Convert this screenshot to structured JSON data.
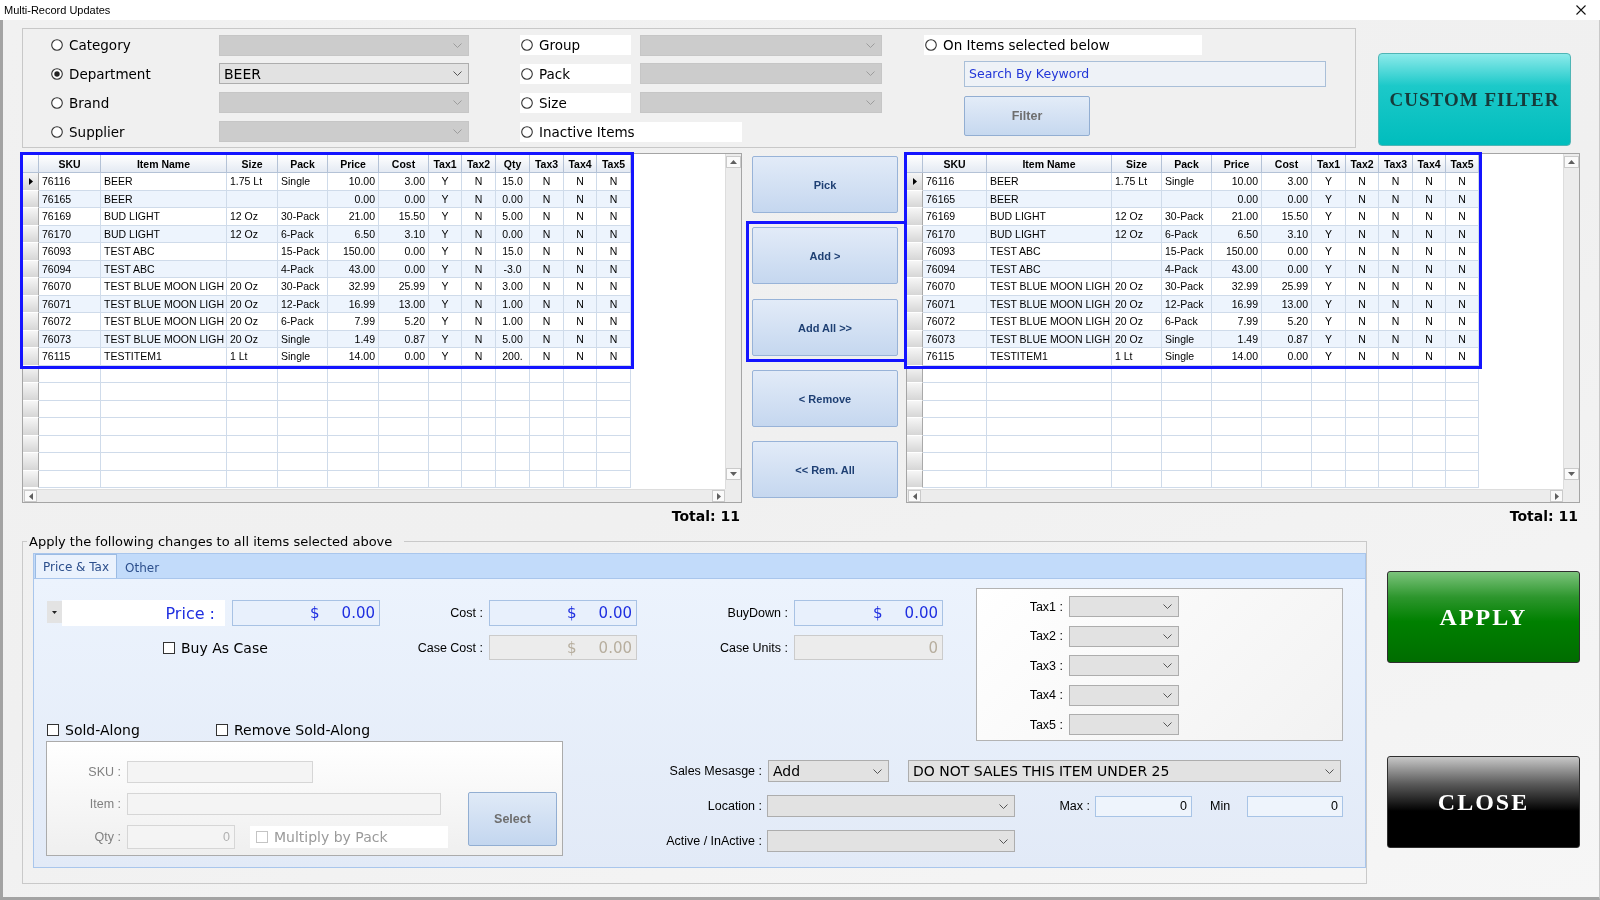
{
  "window": {
    "title": "Multi-Record Updates"
  },
  "filters": {
    "options": [
      {
        "label": "Category",
        "selected": false,
        "select": {
          "disabled": true
        }
      },
      {
        "label": "Department",
        "selected": true,
        "select": {
          "value": "BEER",
          "disabled": false
        }
      },
      {
        "label": "Brand",
        "selected": false,
        "select": {
          "disabled": true
        }
      },
      {
        "label": "Supplier",
        "selected": false,
        "select": {
          "disabled": true
        }
      },
      {
        "label": "Group",
        "selected": false,
        "select": {
          "disabled": true
        }
      },
      {
        "label": "Pack",
        "selected": false,
        "select": {
          "disabled": true
        }
      },
      {
        "label": "Size",
        "selected": false,
        "select": {
          "disabled": true
        }
      },
      {
        "label": "Inactive Items",
        "selected": false
      },
      {
        "label": "On Items selected below",
        "selected": false
      }
    ],
    "search": {
      "placeholder": "Search By Keyword"
    },
    "filter_button": {
      "label": "Filter",
      "disabled": true
    }
  },
  "custom_filter_button": {
    "label": "CUSTOM FILTER"
  },
  "left_grid": {
    "highlighted": true,
    "columns": [
      "SKU",
      "Item Name",
      "Size",
      "Pack",
      "Price",
      "Cost",
      "Tax1",
      "Tax2",
      "Qty",
      "Tax3",
      "Tax4",
      "Tax5"
    ],
    "rows": [
      {
        "selected": true,
        "cells": [
          "76116",
          "BEER",
          "1.75 Lt",
          "Single",
          "10.00",
          "3.00",
          "Y",
          "N",
          "15.0",
          "N",
          "N",
          "N"
        ]
      },
      {
        "selected": false,
        "cells": [
          "76165",
          "BEER",
          null,
          null,
          "0.00",
          "0.00",
          "Y",
          "N",
          "0.00",
          "N",
          "N",
          "N"
        ]
      },
      {
        "selected": false,
        "cells": [
          "76169",
          "BUD LIGHT",
          "12 Oz",
          "30-Pack",
          "21.00",
          "15.50",
          "Y",
          "N",
          "5.00",
          "N",
          "N",
          "N"
        ]
      },
      {
        "selected": false,
        "cells": [
          "76170",
          "BUD LIGHT",
          "12 Oz",
          "6-Pack",
          "6.50",
          "3.10",
          "Y",
          "N",
          "0.00",
          "N",
          "N",
          "N"
        ]
      },
      {
        "selected": false,
        "cells": [
          "76093",
          "TEST ABC",
          null,
          "15-Pack",
          "150.00",
          "0.00",
          "Y",
          "N",
          "15.0",
          "N",
          "N",
          "N"
        ]
      },
      {
        "selected": false,
        "cells": [
          "76094",
          "TEST ABC",
          null,
          "4-Pack",
          "43.00",
          "0.00",
          "Y",
          "N",
          "-3.0",
          "N",
          "N",
          "N"
        ]
      },
      {
        "selected": false,
        "cells": [
          "76070",
          "TEST BLUE MOON LIGH",
          "20 Oz",
          "30-Pack",
          "32.99",
          "25.99",
          "Y",
          "N",
          "3.00",
          "N",
          "N",
          "N"
        ]
      },
      {
        "selected": false,
        "cells": [
          "76071",
          "TEST BLUE MOON LIGH",
          "20 Oz",
          "12-Pack",
          "16.99",
          "13.00",
          "Y",
          "N",
          "1.00",
          "N",
          "N",
          "N"
        ]
      },
      {
        "selected": false,
        "cells": [
          "76072",
          "TEST BLUE MOON LIGH",
          "20 Oz",
          "6-Pack",
          "7.99",
          "5.20",
          "Y",
          "N",
          "1.00",
          "N",
          "N",
          "N"
        ]
      },
      {
        "selected": false,
        "cells": [
          "76073",
          "TEST BLUE MOON LIGH",
          "20 Oz",
          "Single",
          "1.49",
          "0.87",
          "Y",
          "N",
          "5.00",
          "N",
          "N",
          "N"
        ]
      },
      {
        "selected": false,
        "cells": [
          "76115",
          "TESTITEM1",
          "1 Lt",
          "Single",
          "14.00",
          "0.00",
          "Y",
          "N",
          "200.",
          "N",
          "N",
          "N"
        ]
      }
    ],
    "total": "Total: 11"
  },
  "transfer_buttons": [
    {
      "label": "Pick",
      "highlighted": false
    },
    {
      "label": "Add >",
      "highlighted": true
    },
    {
      "label": "Add All >>",
      "highlighted": true
    },
    {
      "label": "< Remove",
      "highlighted": false
    },
    {
      "label": "<< Rem. All",
      "highlighted": false
    }
  ],
  "right_grid": {
    "highlighted": true,
    "columns": [
      "SKU",
      "Item Name",
      "Size",
      "Pack",
      "Price",
      "Cost",
      "Tax1",
      "Tax2",
      "Tax3",
      "Tax4",
      "Tax5"
    ],
    "rows": [
      {
        "selected": true,
        "cells": [
          "76116",
          "BEER",
          "1.75 Lt",
          "Single",
          "10.00",
          "3.00",
          "Y",
          "N",
          "N",
          "N",
          "N"
        ]
      },
      {
        "selected": false,
        "cells": [
          "76165",
          "BEER",
          null,
          null,
          "0.00",
          "0.00",
          "Y",
          "N",
          "N",
          "N",
          "N"
        ]
      },
      {
        "selected": false,
        "cells": [
          "76169",
          "BUD LIGHT",
          "12 Oz",
          "30-Pack",
          "21.00",
          "15.50",
          "Y",
          "N",
          "N",
          "N",
          "N"
        ]
      },
      {
        "selected": false,
        "cells": [
          "76170",
          "BUD LIGHT",
          "12 Oz",
          "6-Pack",
          "6.50",
          "3.10",
          "Y",
          "N",
          "N",
          "N",
          "N"
        ]
      },
      {
        "selected": false,
        "cells": [
          "76093",
          "TEST ABC",
          null,
          "15-Pack",
          "150.00",
          "0.00",
          "Y",
          "N",
          "N",
          "N",
          "N"
        ]
      },
      {
        "selected": false,
        "cells": [
          "76094",
          "TEST ABC",
          null,
          "4-Pack",
          "43.00",
          "0.00",
          "Y",
          "N",
          "N",
          "N",
          "N"
        ]
      },
      {
        "selected": false,
        "cells": [
          "76070",
          "TEST BLUE MOON LIGH",
          "20 Oz",
          "30-Pack",
          "32.99",
          "25.99",
          "Y",
          "N",
          "N",
          "N",
          "N"
        ]
      },
      {
        "selected": false,
        "cells": [
          "76071",
          "TEST BLUE MOON LIGH",
          "20 Oz",
          "12-Pack",
          "16.99",
          "13.00",
          "Y",
          "N",
          "N",
          "N",
          "N"
        ]
      },
      {
        "selected": false,
        "cells": [
          "76072",
          "TEST BLUE MOON LIGH",
          "20 Oz",
          "6-Pack",
          "7.99",
          "5.20",
          "Y",
          "N",
          "N",
          "N",
          "N"
        ]
      },
      {
        "selected": false,
        "cells": [
          "76073",
          "TEST BLUE MOON LIGH",
          "20 Oz",
          "Single",
          "1.49",
          "0.87",
          "Y",
          "N",
          "N",
          "N",
          "N"
        ]
      },
      {
        "selected": false,
        "cells": [
          "76115",
          "TESTITEM1",
          "1 Lt",
          "Single",
          "14.00",
          "0.00",
          "Y",
          "N",
          "N",
          "N",
          "N"
        ]
      }
    ],
    "total": "Total: 11"
  },
  "changes": {
    "title": "Apply the following changes to all items selected above",
    "tabs": [
      {
        "label": "Price & Tax",
        "selected": true
      },
      {
        "label": "Other",
        "selected": false
      }
    ],
    "price": {
      "label": "Price :",
      "currency": "$",
      "value": "0.00"
    },
    "cost": {
      "label": "Cost :",
      "currency": "$",
      "value": "0.00",
      "disabled": false
    },
    "buydown": {
      "label": "BuyDown :",
      "currency": "$",
      "value": "0.00",
      "disabled": false
    },
    "buy_as_case": {
      "label": "Buy As Case",
      "checked": false
    },
    "case_cost": {
      "label": "Case Cost :",
      "currency": "$",
      "value": "0.00",
      "disabled": true
    },
    "case_units": {
      "label": "Case Units :",
      "value": "0",
      "disabled": true
    },
    "taxes": [
      {
        "label": "Tax1 :"
      },
      {
        "label": "Tax2 :"
      },
      {
        "label": "Tax3 :"
      },
      {
        "label": "Tax4 :"
      },
      {
        "label": "Tax5 :"
      }
    ],
    "sold_along": {
      "checkbox": {
        "label": "Sold-Along",
        "checked": false
      },
      "remove_checkbox": {
        "label": "Remove Sold-Along",
        "checked": false
      },
      "fields": [
        {
          "label": "SKU :",
          "disabled": true
        },
        {
          "label": "Item :",
          "disabled": true
        },
        {
          "label": "Qty :",
          "value": "0",
          "disabled": true
        }
      ],
      "multiply_by_pack": {
        "label": "Multiply by Pack",
        "checked": false,
        "disabled": true
      },
      "select_button": {
        "label": "Select",
        "disabled": true
      }
    },
    "sales_message": {
      "label": "Sales Mesasge :",
      "action": "Add",
      "message": "DO NOT SALES THIS ITEM UNDER 25"
    },
    "location": {
      "label": "Location :"
    },
    "max": {
      "label": "Max :",
      "value": "0"
    },
    "min": {
      "label": "Min",
      "value": "0"
    },
    "active": {
      "label": "Active / InActive :"
    }
  },
  "actions": [
    {
      "label": "APPLY",
      "kind": "apply"
    },
    {
      "label": "CLOSE",
      "kind": "close"
    }
  ]
}
